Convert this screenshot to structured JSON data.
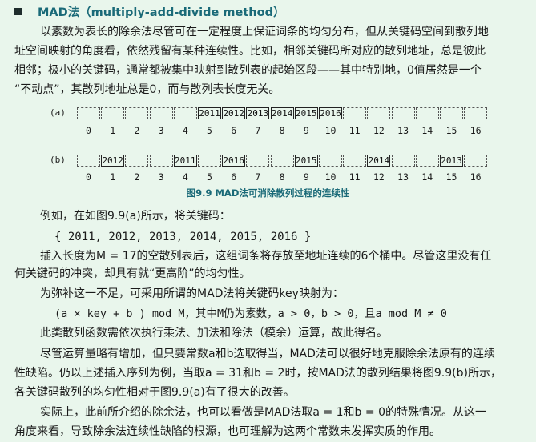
{
  "heading": {
    "title": "MAD法（multiply-add-divide method）"
  },
  "para1": [
    "以素数为表长的除余法尽管可在一定程度上保证词条的均匀分布，但从关键码空间到散列地",
    "址空间映射的角度看，依然残留有某种连续性。比如，相邻关键码所对应的散列地址，总是彼此",
    "相邻；极小的关键码，通常都被集中映射到散列表的起始区段——其中特别地，0值居然是一个",
    "“不动点”，其散列地址总是0，而与散列表长度无关。"
  ],
  "figure": {
    "label_a": "(a)",
    "label_b": "(b)",
    "size": 17,
    "indices": [
      "0",
      "1",
      "2",
      "3",
      "4",
      "5",
      "6",
      "7",
      "8",
      "9",
      "10",
      "11",
      "12",
      "13",
      "14",
      "15",
      "16"
    ],
    "row_a": [
      {
        "slot": 5,
        "key": "2011"
      },
      {
        "slot": 6,
        "key": "2012"
      },
      {
        "slot": 7,
        "key": "2013"
      },
      {
        "slot": 8,
        "key": "2014"
      },
      {
        "slot": 9,
        "key": "2015"
      },
      {
        "slot": 10,
        "key": "2016"
      }
    ],
    "row_b": [
      {
        "slot": 1,
        "key": "2012"
      },
      {
        "slot": 4,
        "key": "2011"
      },
      {
        "slot": 6,
        "key": "2016"
      },
      {
        "slot": 9,
        "key": "2015"
      },
      {
        "slot": 12,
        "key": "2014"
      },
      {
        "slot": 15,
        "key": "2013"
      }
    ],
    "caption": "图9.9 MAD法可消除散列过程的连续性"
  },
  "para2": {
    "intro": "例如，在如图9.9(a)所示，将关键码：",
    "keys": "{ 2011, 2012, 2013, 2014, 2015, 2016 }",
    "l1": "插入长度为M = 17的空散列表后，这组词条将存放至地址连续的6个桶中。尽管这里没有任",
    "l2": "何关键码的冲突，却具有就“更高阶”的均匀性。",
    "l3": "为弥补这一不足，可采用所谓的MAD法将关键码key映射为：",
    "formula": "(a × key + b ) mod M，其中M仍为素数，a > 0，b > 0，且a mod M ≠ 0",
    "l4": "此类散列函数需依次执行乘法、加法和除法（模余）运算，故此得名。"
  },
  "para3": [
    "尽管运算量略有增加，但只要常数a和b选取得当，MAD法可以很好地克服除余法原有的连续",
    "性缺陷。仍以上述插入序列为例，当取a = 31和b = 2时，按MAD法的散列结果将图9.9(b)所示，",
    "各关键码散列的均匀性相对于图9.9(a)有了很大的改善。"
  ],
  "para4": [
    "实际上，此前所介绍的除余法，也可以看做是MAD法取a = 1和b = 0的特殊情况。从这一",
    "角度来看，导致除余法连续性缺陷的根源，也可理解为这两个常数未发挥实质的作用。"
  ]
}
